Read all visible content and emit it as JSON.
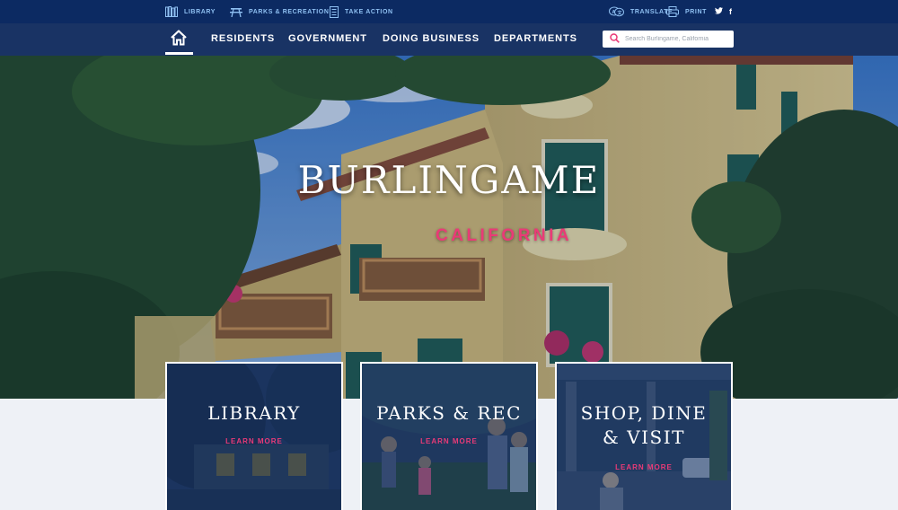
{
  "utility_bar": {
    "links": [
      {
        "label": "LIBRARY",
        "icon": "books-icon"
      },
      {
        "label": "PARKS & RECREATION",
        "icon": "picnic-table-icon"
      },
      {
        "label": "TAKE ACTION",
        "icon": "document-list-icon"
      }
    ],
    "right_links": [
      {
        "label": "TRANSLATE",
        "icon": "translate-icon"
      },
      {
        "label": "PRINT",
        "icon": "print-icon"
      }
    ],
    "social": [
      {
        "label": "𝕏",
        "icon": "twitter-icon"
      },
      {
        "label": "f",
        "icon": "facebook-icon"
      }
    ]
  },
  "nav": {
    "home_icon": "home-icon",
    "items": [
      "RESIDENTS",
      "GOVERNMENT",
      "DOING BUSINESS",
      "DEPARTMENTS"
    ],
    "search_placeholder": "Search Burlingame, California"
  },
  "hero": {
    "title": "BURLINGAME",
    "subtitle": "CALIFORNIA"
  },
  "cards": [
    {
      "title_line1": "LIBRARY",
      "title_line2": "",
      "link": "LEARN MORE"
    },
    {
      "title_line1": "PARKS & REC",
      "title_line2": "",
      "link": "LEARN MORE"
    },
    {
      "title_line1": "SHOP, DINE",
      "title_line2": "& VISIT",
      "link": "LEARN MORE"
    }
  ],
  "colors": {
    "utility_bg": "#0c2a62",
    "nav_bg": "#102b5e",
    "accent_pink": "#ea3a77",
    "link_blue": "#8fc0f2"
  }
}
